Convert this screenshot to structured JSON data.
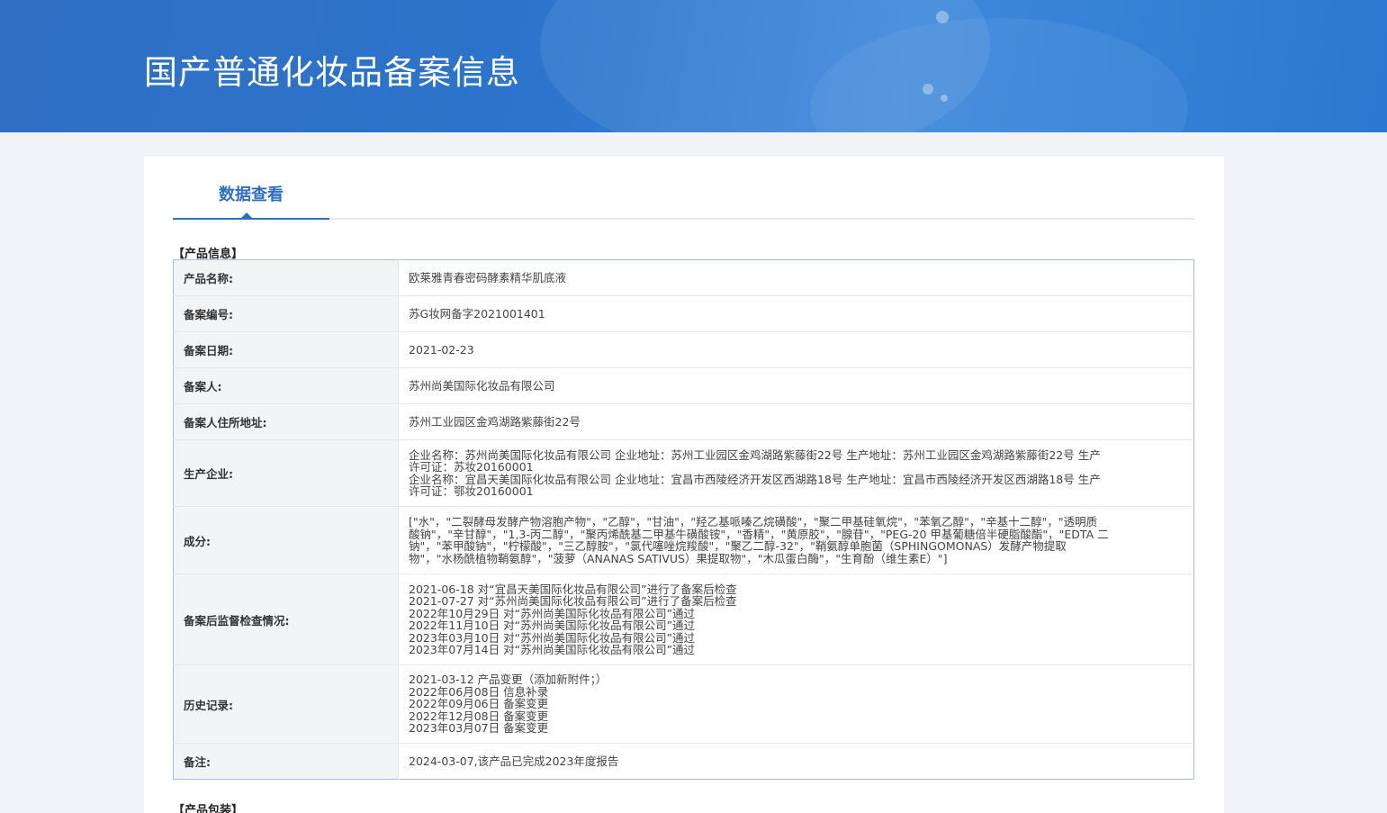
{
  "header": {
    "title": "国产普通化妆品备案信息"
  },
  "tabs": [
    {
      "label": "数据查看"
    }
  ],
  "sections": {
    "product_info": "【产品信息】",
    "product_packaging": "【产品包装】"
  },
  "rows": {
    "product_name": {
      "label": "产品名称:",
      "value": "欧莱雅青春密码酵素精华肌底液"
    },
    "record_number": {
      "label": "备案编号:",
      "value": "苏G妆网备字2021001401"
    },
    "record_date": {
      "label": "备案日期:",
      "value": "2021-02-23"
    },
    "registrant": {
      "label": "备案人:",
      "value": "苏州尚美国际化妆品有限公司"
    },
    "address": {
      "label": "备案人住所地址:",
      "value": "苏州工业园区金鸡湖路紫藤街22号"
    },
    "manufacturer": {
      "label": "生产企业:",
      "lines": [
        "企业名称：苏州尚美国际化妆品有限公司 企业地址：苏州工业园区金鸡湖路紫藤街22号 生产地址：苏州工业园区金鸡湖路紫藤街22号 生产",
        "许可证：苏妆20160001",
        "企业名称：宜昌天美国际化妆品有限公司 企业地址：宜昌市西陵经济开发区西湖路18号 生产地址：宜昌市西陵经济开发区西湖路18号 生产",
        "许可证：鄂妆20160001"
      ]
    },
    "ingredients": {
      "label": "成分:",
      "lines": [
        "[\"水\"，\"二裂酵母发酵产物溶胞产物\"，\"乙醇\"，\"甘油\"，\"羟乙基哌嗪乙烷磺酸\"，\"聚二甲基硅氧烷\"，\"苯氧乙醇\"，\"辛基十二醇\"，\"透明质",
        "酸钠\"，\"辛甘醇\"，\"1,3-丙二醇\"，\"聚丙烯酰基二甲基牛磺酸铵\"，\"香精\"，\"黄原胶\"，\"腺苷\"，\"PEG-20 甲基葡糖倍半硬脂酸酯\"，\"EDTA 二",
        "钠\"，\"苯甲酸钠\"，\"柠檬酸\"，\"三乙醇胺\"，\"氯代噻唑烷羧酸\"，\"聚乙二醇-32\"，\"鞘氨醇单胞菌（SPHINGOMONAS）发酵产物提取",
        "物\"，\"水杨酰植物鞘氨醇\"，\"菠萝（ANANAS SATIVUS）果提取物\"，\"木瓜蛋白酶\"，\"生育酚（维生素E）\"]"
      ]
    },
    "inspections": {
      "label": "备案后监督检查情况:",
      "lines": [
        "2021-06-18 对“宜昌天美国际化妆品有限公司”进行了备案后检查",
        "2021-07-27 对“苏州尚美国际化妆品有限公司”进行了备案后检查",
        "2022年10月29日 对“苏州尚美国际化妆品有限公司”通过",
        "2022年11月10日 对“苏州尚美国际化妆品有限公司”通过",
        "2023年03月10日 对“苏州尚美国际化妆品有限公司”通过",
        "2023年07月14日 对“苏州尚美国际化妆品有限公司”通过"
      ]
    },
    "history": {
      "label": "历史记录:",
      "lines": [
        "2021-03-12 产品变更（添加新附件；）",
        "2022年06月08日 信息补录",
        "2022年09月06日 备案变更",
        "2022年12月08日 备案变更",
        "2023年03月07日 备案变更"
      ]
    },
    "remarks": {
      "label": "备注:",
      "value": "2024-03-07,该产品已完成2023年度报告"
    }
  }
}
